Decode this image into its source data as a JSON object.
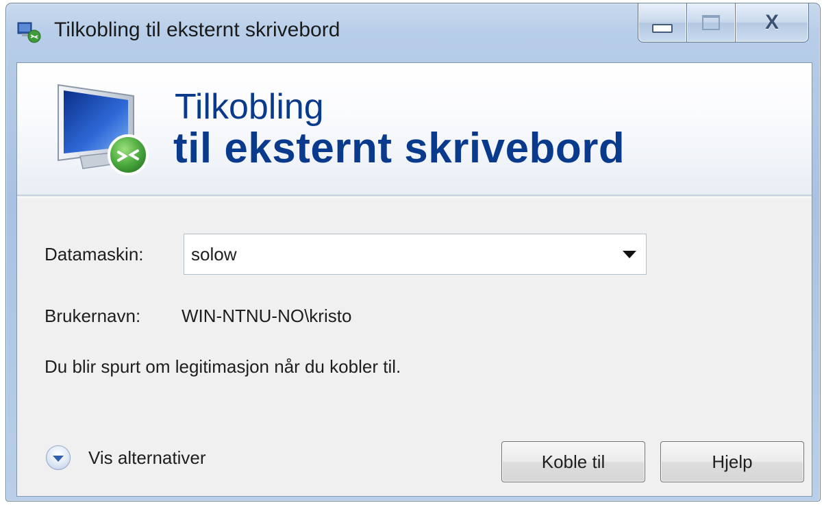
{
  "window": {
    "title": "Tilkobling til eksternt skrivebord",
    "caption_buttons": [
      "minimize",
      "maximize",
      "close"
    ]
  },
  "banner": {
    "heading_line1": "Tilkobling",
    "heading_line2": "til eksternt skrivebord"
  },
  "form": {
    "computer_label": "Datamaskin:",
    "computer_value": "solow",
    "username_label": "Brukernavn:",
    "username_value": "WIN-NTNU-NO\\kristo",
    "info_text": "Du blir spurt om legitimasjon når du kobler til."
  },
  "footer": {
    "options_label": "Vis alternativer",
    "connect_label": "Koble til",
    "help_label": "Hjelp"
  },
  "icons": {
    "app": "remote-desktop-icon",
    "banner": "monitor-remote-icon",
    "options": "chevron-down-circle-icon"
  },
  "colors": {
    "heading": "#0a3a8c",
    "client_bg": "#f0f0f0",
    "frame": "#b7cde8"
  }
}
